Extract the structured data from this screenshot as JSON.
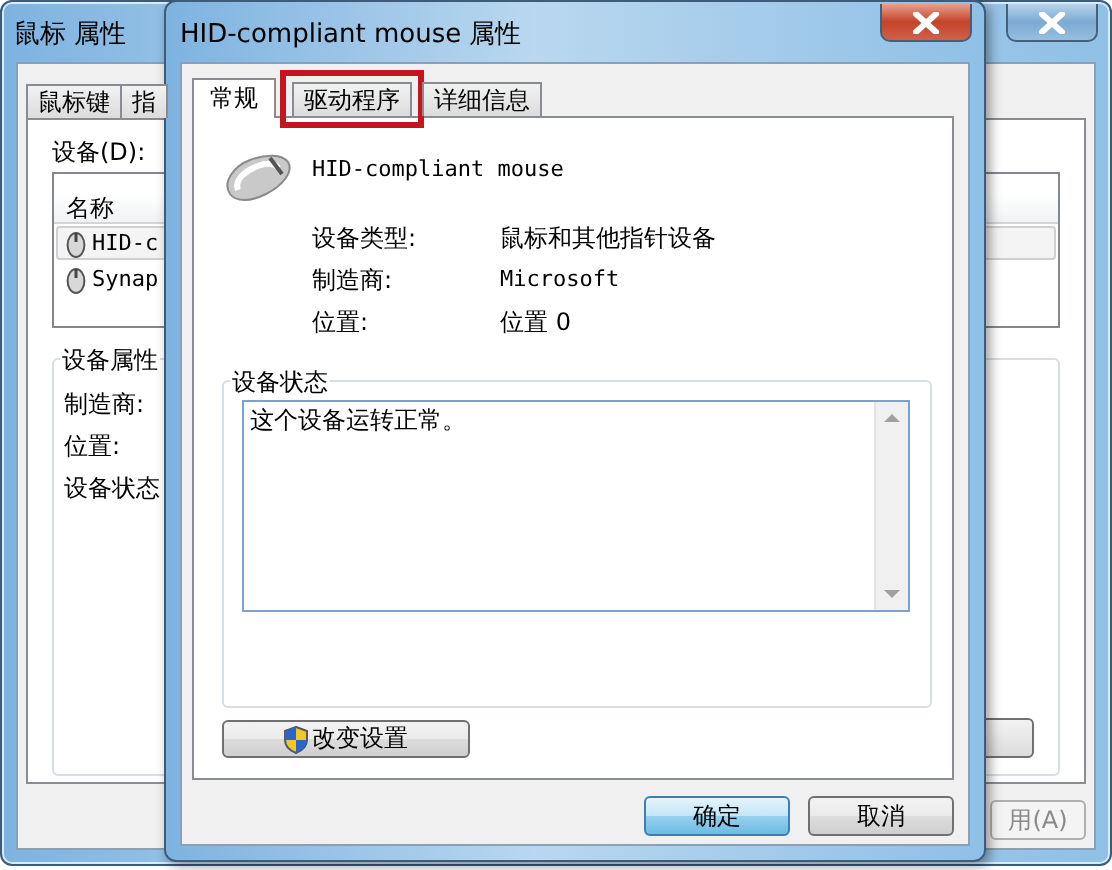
{
  "back_window": {
    "title": "鼠标 属性",
    "tabs": [
      {
        "label": "鼠标键",
        "selected": false
      },
      {
        "label": "指",
        "selected": false
      }
    ],
    "devices_label": "设备(D):",
    "list_header": "名称",
    "devices": [
      {
        "name": "HID-c",
        "selected": true
      },
      {
        "name": "Synap",
        "selected": false
      }
    ],
    "group_title": "设备属性",
    "fields": [
      "制造商:",
      "位置:",
      "设备状态"
    ],
    "apply_button": "用(A)"
  },
  "dialog": {
    "title": "HID-compliant mouse 属性",
    "tabs": [
      {
        "label": "常规",
        "selected": true,
        "annotated": false
      },
      {
        "label": "驱动程序",
        "selected": false,
        "annotated": true
      },
      {
        "label": "详细信息",
        "selected": false,
        "annotated": false
      }
    ],
    "device_name": "HID-compliant mouse",
    "properties": [
      {
        "label": "设备类型:",
        "value": "鼠标和其他指针设备"
      },
      {
        "label": "制造商:",
        "value": "Microsoft"
      },
      {
        "label": "位置:",
        "value": "位置 0"
      }
    ],
    "status_group": "设备状态",
    "status_text": "这个设备运转正常。",
    "change_button": "改变设置",
    "buttons": [
      {
        "label": "确定",
        "default": true
      },
      {
        "label": "取消",
        "default": false
      }
    ]
  }
}
